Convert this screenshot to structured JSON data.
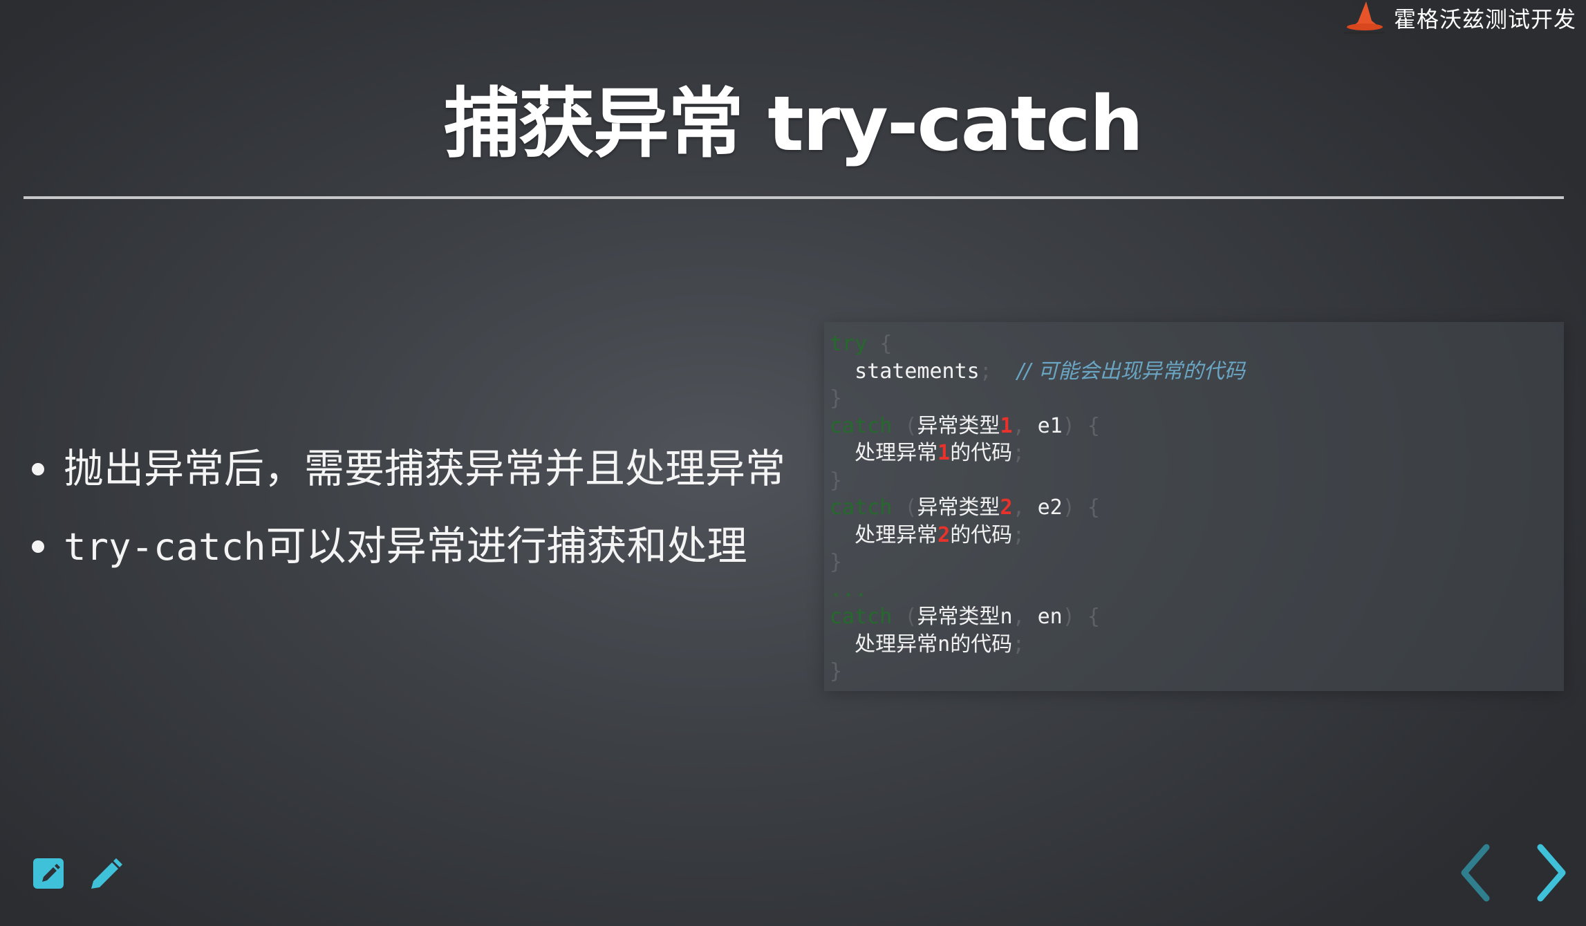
{
  "brand": {
    "logo_icon": "wizard-hat-icon",
    "name": "霍格沃兹测试开发"
  },
  "slide": {
    "title": "捕获异常 try-catch",
    "bullets": [
      {
        "prefix": "",
        "text": "抛出异常后，需要捕获异常并且处理异常"
      },
      {
        "prefix": "try-catch",
        "text": "可以对异常进行捕获和处理"
      }
    ]
  },
  "code": {
    "try_kw": "try",
    "catch_kw": "catch",
    "open_brace": "{",
    "close_brace": "}",
    "open_paren": "(",
    "close_paren": ")",
    "comma": ",",
    "semicolon": ";",
    "statements": "statements",
    "comment": "// 可能会出现异常的代码",
    "exception_type": "异常类型",
    "handle_prefix": "处理异常",
    "handle_suffix": "的代码",
    "blocks": [
      {
        "n": "1",
        "var": "e1"
      },
      {
        "n": "2",
        "var": "e2"
      }
    ],
    "ellipsis": "...",
    "last_n": "n",
    "last_var": "en"
  },
  "toolbar": {
    "edit_icon": "edit-square-icon",
    "pen_icon": "pencil-icon"
  },
  "nav": {
    "prev_icon": "chevron-left-icon",
    "next_icon": "chevron-right-icon"
  },
  "colors": {
    "accent": "#3fc1d9",
    "keyword": "#256a2c",
    "comment": "#6aa6c4",
    "highlight": "#e8322c"
  }
}
